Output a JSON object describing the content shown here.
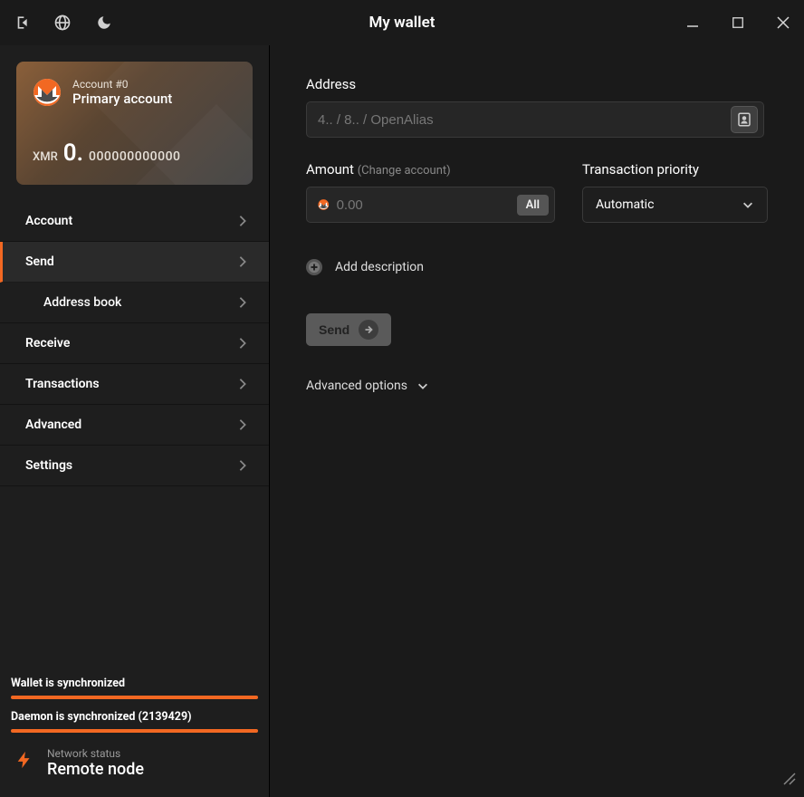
{
  "window": {
    "title": "My wallet"
  },
  "account_card": {
    "account_num_label": "Account #0",
    "account_name": "Primary account",
    "currency_label": "XMR",
    "balance_int": "0.",
    "balance_frac": "000000000000"
  },
  "nav": {
    "account": "Account",
    "send": "Send",
    "address_book": "Address book",
    "receive": "Receive",
    "transactions": "Transactions",
    "advanced": "Advanced",
    "settings": "Settings"
  },
  "sync": {
    "wallet_label": "Wallet is synchronized",
    "daemon_label": "Daemon is synchronized (2139429)"
  },
  "network": {
    "status_label": "Network status",
    "status_value": "Remote node"
  },
  "send_form": {
    "address_label": "Address",
    "address_placeholder": "4.. / 8.. / OpenAlias",
    "amount_label": "Amount",
    "amount_hint": "(Change account)",
    "amount_placeholder": "0.00",
    "all_button": "All",
    "priority_label": "Transaction priority",
    "priority_value": "Automatic",
    "add_description": "Add description",
    "send_button": "Send",
    "advanced_options": "Advanced options"
  },
  "colors": {
    "accent": "#f26822"
  }
}
